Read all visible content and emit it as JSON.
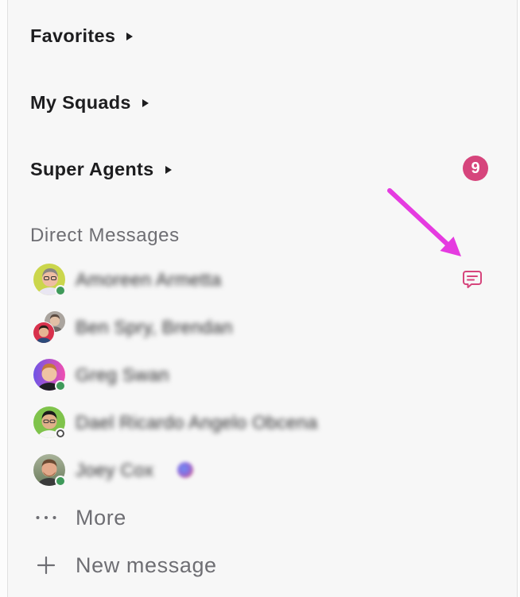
{
  "sidebar": {
    "sections": [
      {
        "label": "Favorites",
        "icon": "caret-right-icon"
      },
      {
        "label": "My Squads",
        "icon": "caret-right-icon"
      },
      {
        "label": "Super Agents",
        "icon": "caret-right-icon",
        "badge": "9"
      }
    ],
    "direct_messages": {
      "header": "Direct Messages",
      "items": [
        {
          "name": "Amoreen Armetta",
          "avatar_icon": "user-avatar-icon",
          "presence_icon": "presence-online-icon",
          "action_icon": "message-icon"
        },
        {
          "name": "Ben Spry, Brendan",
          "avatar_icon": "group-avatar-icon"
        },
        {
          "name": "Greg Swan",
          "avatar_icon": "user-avatar-icon",
          "presence_icon": "presence-online-icon"
        },
        {
          "name": "Dael Ricardo Angelo Obcena",
          "avatar_icon": "user-avatar-icon",
          "presence_icon": "presence-offline-icon"
        },
        {
          "name": "Joey Cox",
          "avatar_icon": "user-avatar-icon",
          "presence_icon": "presence-online-icon",
          "status_icon": "status-emoji-icon"
        }
      ]
    },
    "more": {
      "label": "More",
      "icon": "ellipsis-icon"
    },
    "new_message": {
      "label": "New message",
      "icon": "plus-icon"
    }
  },
  "annotation": {
    "icon": "arrow-annotation-icon"
  },
  "colors": {
    "background": "#f7f7f7",
    "heading_text": "#1d1d1f",
    "muted_text": "#6e6e73",
    "accent": "#d6457c",
    "online": "#3f9a5a",
    "annotation_arrow": "#e53be0"
  }
}
